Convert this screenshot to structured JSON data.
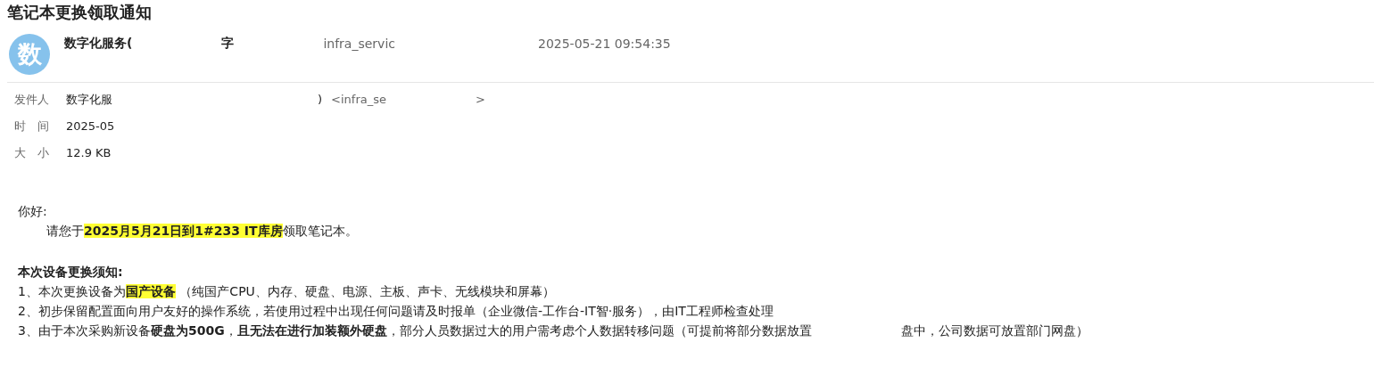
{
  "subject": "笔记本更换领取通知",
  "avatar": {
    "letter": "数"
  },
  "sender_line": {
    "fragments": [
      "数字化服务(",
      "字",
      "infra_servic"
    ],
    "date": "2025-05-21 09:54:35"
  },
  "meta": [
    {
      "label": "发件人",
      "fragments": [
        "数字化服",
        ")",
        "<infra_se",
        ">"
      ]
    },
    {
      "label": "时　间",
      "fragments": [
        "2025-05"
      ]
    },
    {
      "label": "大　小",
      "fragments": [
        "12.9 KB"
      ]
    }
  ],
  "body": [
    {
      "kind": "line",
      "indent": false,
      "segments": [
        {
          "text": "你好:",
          "bold": false,
          "highlight": false
        }
      ]
    },
    {
      "kind": "line",
      "indent": true,
      "segments": [
        {
          "text": "请您于",
          "bold": false,
          "highlight": false
        },
        {
          "text": "2025月5月21日到1#233 IT库房",
          "bold": true,
          "highlight": true
        },
        {
          "text": "领取笔记本。",
          "bold": false,
          "highlight": false
        }
      ]
    },
    {
      "kind": "blank"
    },
    {
      "kind": "line",
      "indent": false,
      "segments": [
        {
          "text": "本次设备更换须知:",
          "bold": true,
          "highlight": false
        }
      ]
    },
    {
      "kind": "line",
      "indent": false,
      "segments": [
        {
          "text": "1、本次更换设备为",
          "bold": false,
          "highlight": false
        },
        {
          "text": "国产设备",
          "bold": true,
          "highlight": true
        },
        {
          "text": " （纯国产CPU、内存、硬盘、电源、主板、声卡、无线模块和屏幕）",
          "bold": false,
          "highlight": false
        }
      ]
    },
    {
      "kind": "line",
      "indent": false,
      "segments": [
        {
          "text": "2、初步保留配置面向用户友好的操作系统，若使用过程中出现任何问题请及时报单（企业微信-工作台-IT智·服务），由IT工程师检查处理",
          "bold": false,
          "highlight": false
        }
      ]
    },
    {
      "kind": "line",
      "indent": false,
      "segments": [
        {
          "text": "3、由于本次采购新设备",
          "bold": false,
          "highlight": false
        },
        {
          "text": "硬盘为500G",
          "bold": true,
          "highlight": false
        },
        {
          "text": "，",
          "bold": false,
          "highlight": false
        },
        {
          "text": "且无法在进行加装额外硬盘",
          "bold": true,
          "highlight": false
        },
        {
          "text": "，部分人员数据过大的用户需考虑个人数据转移问题（可提前将部分数据放置",
          "bold": false,
          "highlight": false
        },
        {
          "text": "盘中，公司数据可放置部门网盘）",
          "bold": false,
          "highlight": false,
          "gap": true
        }
      ]
    }
  ]
}
